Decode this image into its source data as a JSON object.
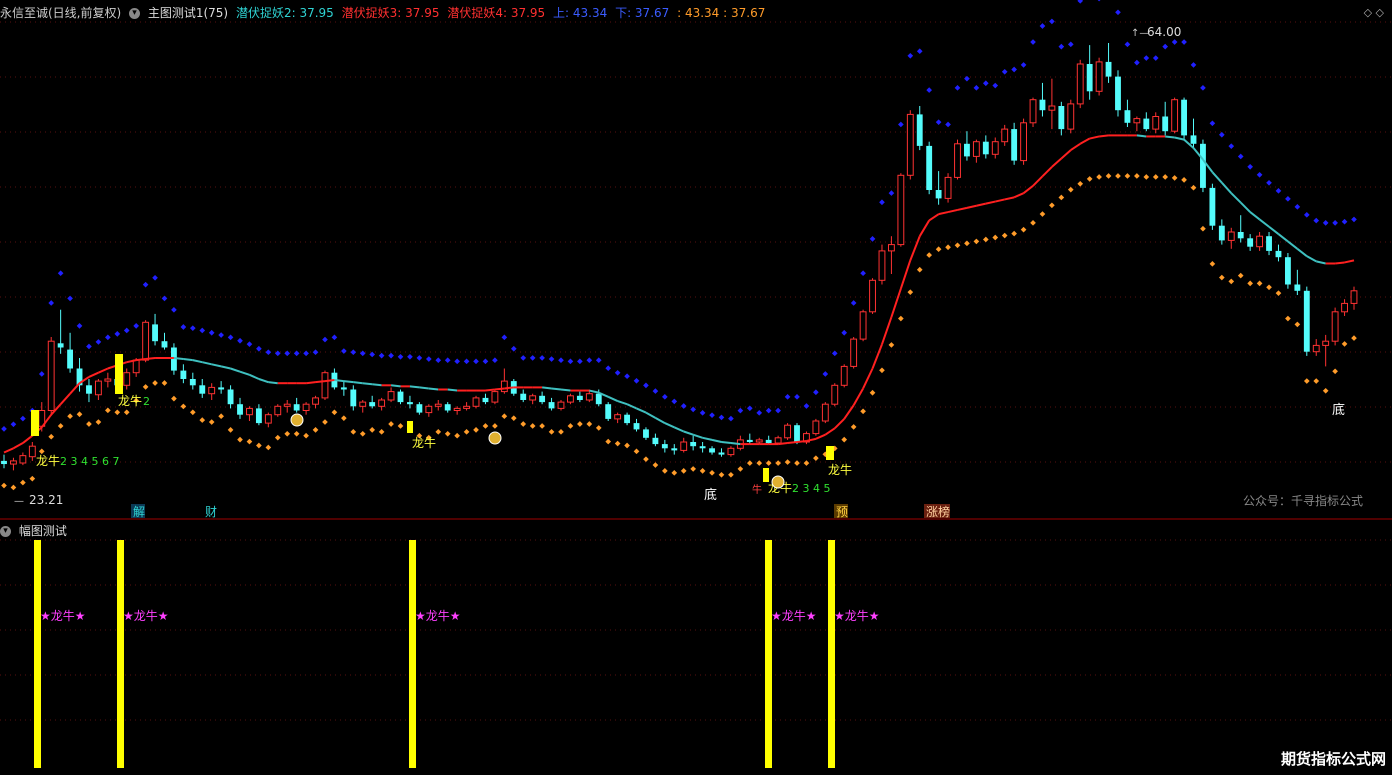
{
  "main": {
    "stock_title": "永信至诚(日线,前复权)",
    "indicator_name": "主图测试1(75)",
    "ind1": "潜伏捉妖2: 37.95",
    "ind2": "潜伏捉妖3: 37.95",
    "ind3": "潜伏捉妖4: 37.95",
    "up_label": "上: 43.34",
    "down_label": "下: 37.67",
    "extra": ": 43.34 : 37.67",
    "corner_glyphs": "◇ ◇",
    "high_label": "64.00",
    "low_label": "23.21",
    "wechat": "公众号：千寻指标公式",
    "labels": {
      "dragon": "龙牛",
      "bottom": "底",
      "jie": "解",
      "cai": "财",
      "yu": "预",
      "zhangting": "涨榜",
      "seq_a": "2 3 4 5 6 7",
      "seq_b": "2 3 4 5",
      "seq_c": "2",
      "niu": "牛"
    }
  },
  "sub": {
    "title": "幅图测试",
    "bar_label": "★龙牛★"
  },
  "watermark": "期货指标公式网",
  "colors": {
    "up": "#ff3232",
    "down": "#54fcfc",
    "ma_red": "#ff2020",
    "ma_cyan": "#3fc0c0",
    "dot_blue": "#2020ff",
    "dot_orange": "#ff9c2a",
    "bar_yellow": "#ffff00",
    "magenta": "#ff40ff"
  },
  "chart_data": {
    "type": "candlestick",
    "price_range": [
      20,
      66
    ],
    "candles": [
      [
        24.2,
        24.8,
        23.5,
        23.9
      ],
      [
        23.9,
        24.5,
        23.3,
        24.2
      ],
      [
        24.0,
        25.0,
        23.8,
        24.7
      ],
      [
        24.6,
        26.0,
        24.2,
        25.6
      ],
      [
        27.5,
        29.8,
        27.0,
        29.0
      ],
      [
        29.0,
        36.0,
        28.5,
        35.6
      ],
      [
        35.4,
        38.6,
        34.4,
        35.0
      ],
      [
        34.8,
        36.4,
        32.6,
        33.0
      ],
      [
        33.0,
        34.0,
        30.8,
        31.4
      ],
      [
        31.4,
        32.0,
        29.8,
        30.6
      ],
      [
        30.5,
        32.0,
        30.0,
        31.8
      ],
      [
        31.8,
        32.6,
        31.2,
        32.0
      ],
      [
        32.0,
        32.8,
        31.0,
        31.4
      ],
      [
        31.4,
        33.0,
        31.0,
        32.6
      ],
      [
        32.6,
        34.0,
        32.2,
        33.8
      ],
      [
        33.8,
        37.6,
        33.6,
        37.4
      ],
      [
        37.2,
        38.2,
        35.2,
        35.6
      ],
      [
        35.6,
        36.4,
        34.8,
        35.0
      ],
      [
        35.0,
        35.4,
        32.4,
        32.8
      ],
      [
        32.8,
        33.4,
        31.6,
        32.0
      ],
      [
        32.0,
        32.6,
        31.0,
        31.4
      ],
      [
        31.4,
        32.0,
        30.2,
        30.6
      ],
      [
        30.6,
        31.6,
        30.0,
        31.2
      ],
      [
        31.2,
        31.8,
        30.6,
        31.0
      ],
      [
        31.0,
        31.4,
        29.2,
        29.6
      ],
      [
        29.6,
        30.2,
        28.2,
        28.6
      ],
      [
        28.6,
        29.4,
        28.0,
        29.2
      ],
      [
        29.2,
        29.6,
        27.6,
        27.8
      ],
      [
        27.8,
        28.8,
        27.4,
        28.6
      ],
      [
        28.6,
        29.6,
        28.4,
        29.4
      ],
      [
        29.4,
        30.0,
        28.8,
        29.6
      ],
      [
        29.6,
        30.2,
        28.8,
        29.0
      ],
      [
        29.0,
        29.8,
        28.6,
        29.6
      ],
      [
        29.6,
        30.4,
        29.2,
        30.2
      ],
      [
        30.2,
        32.8,
        30.0,
        32.6
      ],
      [
        32.6,
        33.0,
        31.0,
        31.2
      ],
      [
        31.2,
        31.8,
        30.4,
        31.0
      ],
      [
        31.0,
        31.4,
        29.0,
        29.4
      ],
      [
        29.4,
        30.0,
        28.8,
        29.8
      ],
      [
        29.8,
        30.4,
        29.2,
        29.4
      ],
      [
        29.4,
        30.2,
        29.0,
        30.0
      ],
      [
        30.0,
        31.2,
        29.8,
        30.8
      ],
      [
        30.8,
        31.0,
        29.6,
        29.8
      ],
      [
        29.8,
        30.4,
        29.2,
        29.6
      ],
      [
        29.6,
        29.8,
        28.6,
        28.8
      ],
      [
        28.8,
        29.6,
        28.4,
        29.4
      ],
      [
        29.4,
        30.0,
        29.0,
        29.6
      ],
      [
        29.6,
        29.8,
        28.8,
        29.0
      ],
      [
        29.0,
        29.4,
        28.6,
        29.2
      ],
      [
        29.2,
        29.8,
        29.0,
        29.4
      ],
      [
        29.4,
        30.4,
        29.2,
        30.2
      ],
      [
        30.2,
        30.6,
        29.6,
        29.8
      ],
      [
        29.8,
        31.0,
        29.6,
        30.8
      ],
      [
        30.8,
        33.0,
        30.6,
        31.8
      ],
      [
        31.8,
        32.0,
        30.4,
        30.6
      ],
      [
        30.6,
        31.0,
        29.8,
        30.0
      ],
      [
        30.0,
        30.6,
        29.6,
        30.4
      ],
      [
        30.4,
        30.8,
        29.6,
        29.8
      ],
      [
        29.8,
        30.2,
        29.0,
        29.2
      ],
      [
        29.2,
        30.0,
        29.0,
        29.8
      ],
      [
        29.8,
        30.6,
        29.6,
        30.4
      ],
      [
        30.4,
        30.8,
        29.8,
        30.0
      ],
      [
        30.0,
        31.0,
        29.8,
        30.6
      ],
      [
        30.6,
        31.0,
        29.4,
        29.6
      ],
      [
        29.6,
        29.8,
        28.0,
        28.2
      ],
      [
        28.2,
        28.8,
        27.8,
        28.6
      ],
      [
        28.6,
        28.8,
        27.6,
        27.8
      ],
      [
        27.8,
        28.2,
        27.0,
        27.2
      ],
      [
        27.2,
        27.4,
        26.2,
        26.4
      ],
      [
        26.4,
        26.8,
        25.6,
        25.8
      ],
      [
        25.8,
        26.2,
        25.0,
        25.4
      ],
      [
        25.4,
        25.8,
        24.8,
        25.2
      ],
      [
        25.2,
        26.4,
        25.0,
        26.0
      ],
      [
        26.0,
        26.6,
        25.2,
        25.6
      ],
      [
        25.6,
        26.0,
        25.0,
        25.4
      ],
      [
        25.4,
        25.6,
        24.8,
        25.0
      ],
      [
        25.0,
        25.4,
        24.6,
        24.8
      ],
      [
        24.8,
        25.6,
        24.6,
        25.4
      ],
      [
        25.4,
        26.6,
        25.2,
        26.2
      ],
      [
        26.2,
        26.8,
        25.8,
        26.0
      ],
      [
        26.0,
        26.4,
        25.8,
        26.2
      ],
      [
        26.2,
        26.6,
        25.8,
        25.9
      ],
      [
        25.9,
        26.6,
        25.8,
        26.4
      ],
      [
        26.4,
        27.8,
        26.2,
        27.6
      ],
      [
        27.6,
        27.8,
        25.8,
        26.0
      ],
      [
        26.0,
        27.0,
        25.8,
        26.8
      ],
      [
        26.8,
        28.2,
        26.6,
        28.0
      ],
      [
        28.0,
        29.8,
        27.8,
        29.6
      ],
      [
        29.6,
        31.6,
        29.4,
        31.4
      ],
      [
        31.4,
        33.4,
        31.2,
        33.2
      ],
      [
        33.2,
        36.0,
        33.0,
        35.8
      ],
      [
        35.8,
        38.6,
        35.6,
        38.4
      ],
      [
        38.4,
        41.6,
        38.2,
        41.4
      ],
      [
        41.4,
        44.8,
        41.0,
        44.2
      ],
      [
        44.2,
        45.6,
        42.0,
        44.8
      ],
      [
        44.8,
        51.6,
        44.6,
        51.4
      ],
      [
        51.4,
        57.6,
        51.0,
        57.2
      ],
      [
        57.2,
        58.0,
        53.8,
        54.2
      ],
      [
        54.2,
        54.6,
        49.6,
        50.0
      ],
      [
        50.0,
        51.8,
        48.6,
        49.2
      ],
      [
        49.2,
        51.6,
        48.8,
        51.2
      ],
      [
        51.2,
        54.8,
        51.0,
        54.4
      ],
      [
        54.4,
        55.6,
        52.8,
        53.2
      ],
      [
        53.2,
        54.8,
        52.6,
        54.6
      ],
      [
        54.6,
        55.2,
        53.0,
        53.4
      ],
      [
        53.4,
        55.0,
        53.0,
        54.6
      ],
      [
        54.6,
        56.2,
        54.2,
        55.8
      ],
      [
        55.8,
        56.4,
        52.4,
        52.8
      ],
      [
        52.8,
        56.8,
        52.4,
        56.4
      ],
      [
        56.4,
        58.8,
        56.0,
        58.6
      ],
      [
        58.6,
        60.2,
        57.0,
        57.6
      ],
      [
        57.6,
        60.6,
        55.8,
        58.0
      ],
      [
        58.0,
        58.4,
        55.2,
        55.8
      ],
      [
        55.8,
        58.6,
        55.4,
        58.2
      ],
      [
        58.2,
        62.4,
        57.8,
        62.0
      ],
      [
        62.0,
        63.8,
        58.6,
        59.4
      ],
      [
        59.4,
        62.6,
        59.0,
        62.2
      ],
      [
        62.2,
        64.0,
        60.2,
        60.8
      ],
      [
        60.8,
        61.4,
        57.0,
        57.6
      ],
      [
        57.6,
        58.6,
        56.0,
        56.4
      ],
      [
        56.4,
        57.0,
        55.6,
        56.8
      ],
      [
        56.8,
        57.4,
        55.6,
        55.8
      ],
      [
        55.8,
        57.4,
        55.4,
        57.0
      ],
      [
        57.0,
        58.4,
        55.2,
        55.6
      ],
      [
        55.6,
        58.8,
        55.4,
        58.6
      ],
      [
        58.6,
        58.8,
        54.8,
        55.2
      ],
      [
        55.2,
        56.8,
        54.0,
        54.4
      ],
      [
        54.4,
        54.8,
        49.8,
        50.2
      ],
      [
        50.2,
        50.6,
        46.2,
        46.6
      ],
      [
        46.6,
        47.2,
        44.8,
        45.2
      ],
      [
        45.2,
        46.4,
        44.4,
        46.0
      ],
      [
        46.0,
        47.6,
        45.0,
        45.4
      ],
      [
        45.4,
        45.8,
        44.2,
        44.6
      ],
      [
        44.6,
        46.0,
        44.2,
        45.6
      ],
      [
        45.6,
        46.0,
        43.8,
        44.2
      ],
      [
        44.2,
        44.8,
        43.2,
        43.6
      ],
      [
        43.6,
        44.0,
        40.6,
        41.0
      ],
      [
        41.0,
        42.4,
        40.0,
        40.4
      ],
      [
        40.4,
        40.8,
        34.2,
        34.6
      ],
      [
        34.6,
        35.8,
        34.2,
        35.2
      ],
      [
        35.2,
        36.2,
        33.2,
        35.6
      ],
      [
        35.6,
        38.8,
        35.2,
        38.4
      ],
      [
        38.4,
        39.6,
        38.0,
        39.2
      ],
      [
        39.2,
        40.8,
        38.6,
        40.4
      ]
    ],
    "ma": [
      25.0,
      25.4,
      25.9,
      26.6,
      27.4,
      28.6,
      29.6,
      30.6,
      31.6,
      32.2,
      32.6,
      33.0,
      33.3,
      33.6,
      33.8,
      33.9,
      34.0,
      34.0,
      34.0,
      33.9,
      33.8,
      33.6,
      33.4,
      33.2,
      33.0,
      32.7,
      32.4,
      32.0,
      31.7,
      31.6,
      31.6,
      31.6,
      31.6,
      31.7,
      31.8,
      31.9,
      31.8,
      31.7,
      31.6,
      31.5,
      31.4,
      31.4,
      31.3,
      31.3,
      31.2,
      31.1,
      31.0,
      31.0,
      30.9,
      30.9,
      30.9,
      30.9,
      31.0,
      31.1,
      31.2,
      31.2,
      31.2,
      31.2,
      31.1,
      31.0,
      30.9,
      30.9,
      30.9,
      30.7,
      30.3,
      29.9,
      29.6,
      29.2,
      28.8,
      28.3,
      27.8,
      27.4,
      27.0,
      26.7,
      26.4,
      26.2,
      26.0,
      25.9,
      25.8,
      25.8,
      25.8,
      25.8,
      25.8,
      25.9,
      26.0,
      26.1,
      26.3,
      26.7,
      27.3,
      28.2,
      29.5,
      31.1,
      33.0,
      35.3,
      37.9,
      40.6,
      43.3,
      45.6,
      47.1,
      47.7,
      47.9,
      48.1,
      48.3,
      48.5,
      48.7,
      48.9,
      49.1,
      49.3,
      49.7,
      50.4,
      51.3,
      52.2,
      53.0,
      53.8,
      54.4,
      54.9,
      55.1,
      55.2,
      55.2,
      55.2,
      55.2,
      55.1,
      55.1,
      55.1,
      55.0,
      54.8,
      54.0,
      52.9,
      51.7,
      50.7,
      49.7,
      48.8,
      47.9,
      47.2,
      46.5,
      45.8,
      45.1,
      44.4,
      43.7,
      43.2,
      43.0,
      43.0,
      43.1,
      43.3
    ]
  }
}
